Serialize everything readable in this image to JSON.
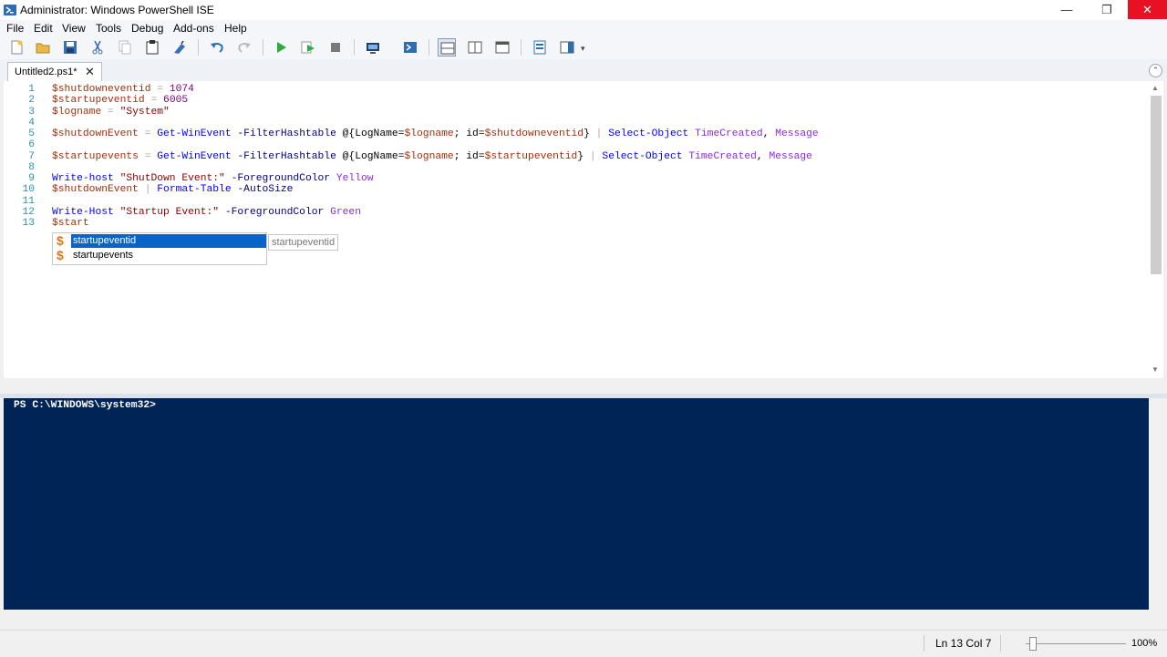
{
  "window": {
    "title": "Administrator: Windows PowerShell ISE",
    "minimize_icon": "—",
    "restore_icon": "❐",
    "close_icon": "✕"
  },
  "menu": [
    "File",
    "Edit",
    "View",
    "Tools",
    "Debug",
    "Add-ons",
    "Help"
  ],
  "toolbar_icons": [
    "new-script-icon",
    "open-icon",
    "save-icon",
    "cut-icon",
    "copy-icon",
    "paste-icon",
    "clear-icon",
    "undo-icon",
    "redo-icon",
    "run-icon",
    "run-selection-icon",
    "stop-icon",
    "new-remote-tab-icon",
    "powershell-console-icon",
    "layout-script-top-icon",
    "layout-script-right-icon",
    "layout-script-max-icon",
    "show-command-icon",
    "show-addon-icon"
  ],
  "tab": {
    "label": "Untitled2.ps1*",
    "close": "✕",
    "collapse_icon": "⌃"
  },
  "editor": {
    "lines": [
      {
        "n": "1",
        "tokens": [
          [
            "var",
            "$shutdowneventid"
          ],
          [
            "op",
            " = "
          ],
          [
            "num",
            "1074"
          ]
        ]
      },
      {
        "n": "2",
        "tokens": [
          [
            "var",
            "$startupeventid"
          ],
          [
            "op",
            " = "
          ],
          [
            "num",
            "6005"
          ]
        ]
      },
      {
        "n": "3",
        "tokens": [
          [
            "var",
            "$logname"
          ],
          [
            "op",
            " = "
          ],
          [
            "str",
            "\"System\""
          ]
        ]
      },
      {
        "n": "4",
        "tokens": []
      },
      {
        "n": "5",
        "tokens": [
          [
            "var",
            "$shutdownEvent"
          ],
          [
            "op",
            " = "
          ],
          [
            "cmd",
            "Get-WinEvent"
          ],
          [
            "sep",
            " "
          ],
          [
            "param",
            "-FilterHashtable"
          ],
          [
            "sep",
            " "
          ],
          [
            "grp",
            "@{LogName="
          ],
          [
            "var",
            "$logname"
          ],
          [
            "grp",
            "; id="
          ],
          [
            "var",
            "$shutdowneventid"
          ],
          [
            "grp",
            "}"
          ],
          [
            "op",
            " | "
          ],
          [
            "cmd",
            "Select-Object"
          ],
          [
            "sep",
            " "
          ],
          [
            "arg",
            "TimeCreated"
          ],
          [
            "grp",
            ", "
          ],
          [
            "arg",
            "Message"
          ]
        ]
      },
      {
        "n": "6",
        "tokens": []
      },
      {
        "n": "7",
        "tokens": [
          [
            "var",
            "$startupevents"
          ],
          [
            "op",
            " = "
          ],
          [
            "cmd",
            "Get-WinEvent"
          ],
          [
            "sep",
            " "
          ],
          [
            "param",
            "-FilterHashtable"
          ],
          [
            "sep",
            " "
          ],
          [
            "grp",
            "@{LogName="
          ],
          [
            "var",
            "$logname"
          ],
          [
            "grp",
            "; id="
          ],
          [
            "var",
            "$startupeventid"
          ],
          [
            "grp",
            "}"
          ],
          [
            "op",
            " | "
          ],
          [
            "cmd",
            "Select-Object"
          ],
          [
            "sep",
            " "
          ],
          [
            "arg",
            "TimeCreated"
          ],
          [
            "grp",
            ", "
          ],
          [
            "arg",
            "Message"
          ]
        ]
      },
      {
        "n": "8",
        "tokens": []
      },
      {
        "n": "9",
        "tokens": [
          [
            "cmd",
            "Write-host"
          ],
          [
            "sep",
            " "
          ],
          [
            "str",
            "\"ShutDown Event:\""
          ],
          [
            "sep",
            " "
          ],
          [
            "param",
            "-ForegroundColor"
          ],
          [
            "sep",
            " "
          ],
          [
            "arg",
            "Yellow"
          ]
        ]
      },
      {
        "n": "10",
        "tokens": [
          [
            "var",
            "$shutdownEvent"
          ],
          [
            "op",
            " | "
          ],
          [
            "cmd",
            "Format-Table"
          ],
          [
            "sep",
            " "
          ],
          [
            "param",
            "-AutoSize"
          ]
        ]
      },
      {
        "n": "11",
        "tokens": []
      },
      {
        "n": "12",
        "tokens": [
          [
            "cmd",
            "Write-Host"
          ],
          [
            "sep",
            " "
          ],
          [
            "str",
            "\"Startup Event:\""
          ],
          [
            "sep",
            " "
          ],
          [
            "param",
            "-ForegroundColor"
          ],
          [
            "sep",
            " "
          ],
          [
            "arg",
            "Green"
          ]
        ]
      },
      {
        "n": "13",
        "tokens": [
          [
            "var",
            "$start"
          ]
        ]
      }
    ]
  },
  "autocomplete": {
    "icon": "$",
    "items": [
      "startupeventid",
      "startupevents"
    ],
    "tooltip": "startupeventid"
  },
  "console": {
    "prompt": "PS C:\\WINDOWS\\system32>"
  },
  "status": {
    "position": "Ln 13  Col 7",
    "zoom_percent": "100%",
    "zoom_level": 100
  },
  "colors": {
    "console_bg": "#012456",
    "close_button": "#e81123",
    "selection": "#0a64c8",
    "variable": "#a0310b",
    "number": "#800080",
    "string": "#8b0000",
    "command": "#0000ff",
    "parameter": "#000080",
    "argument": "#8a2be2",
    "line_number": "#2b91af"
  }
}
